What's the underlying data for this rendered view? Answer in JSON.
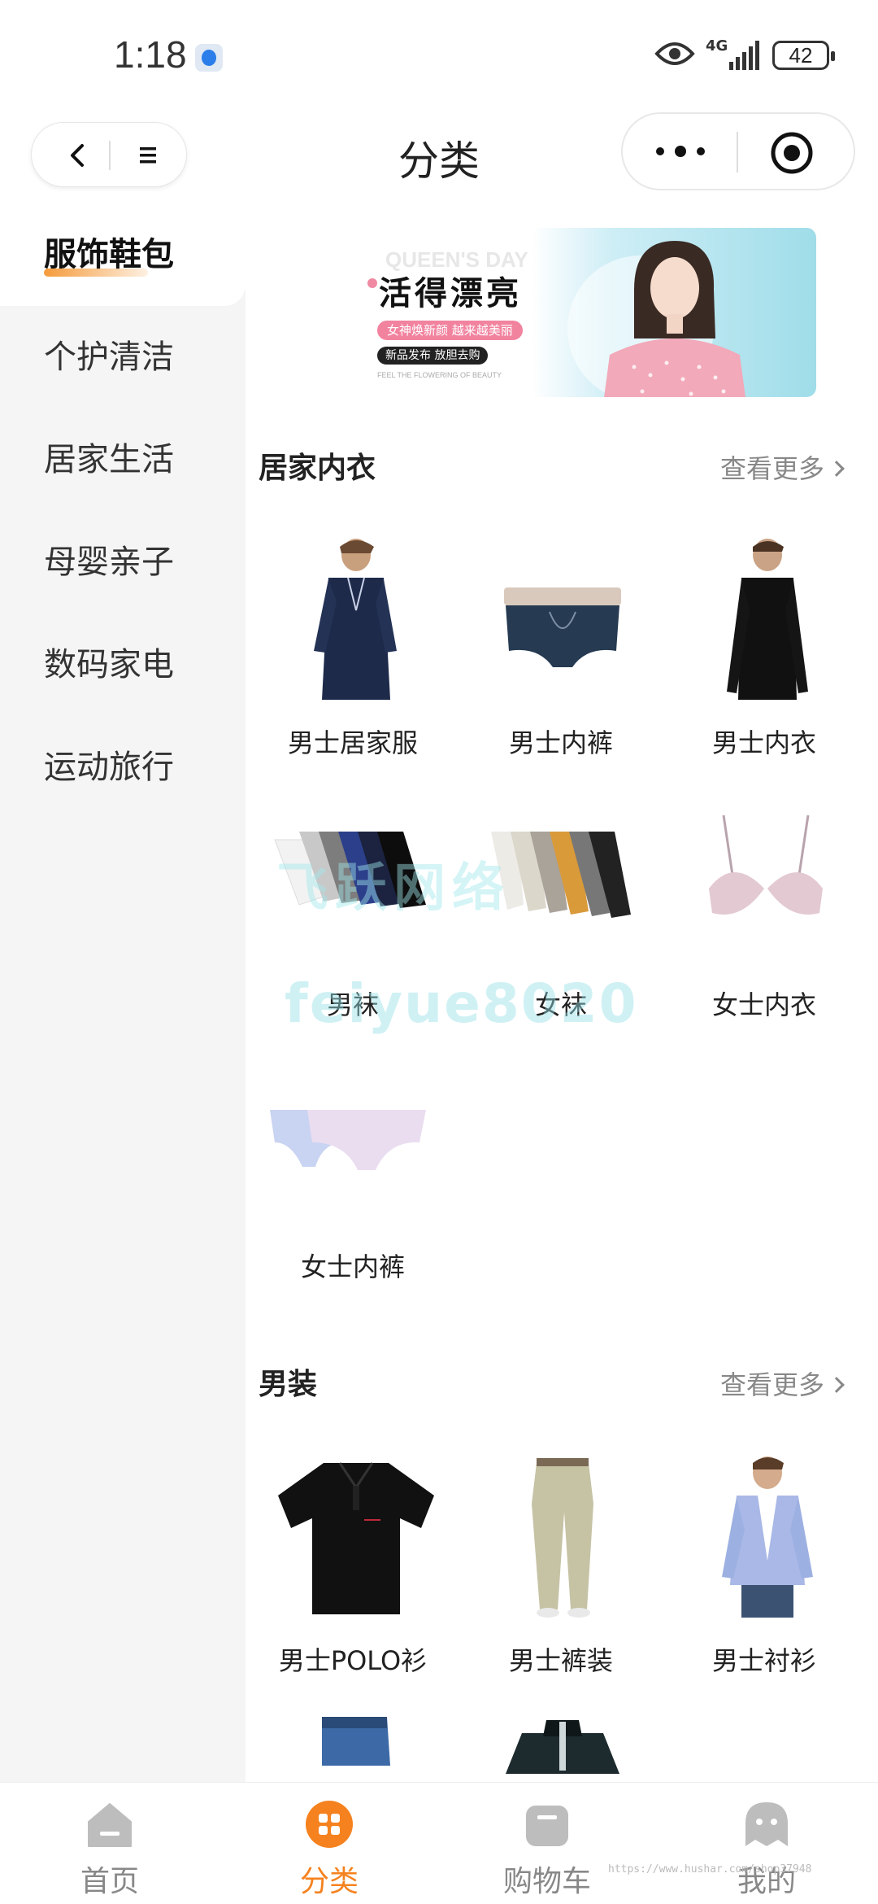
{
  "status_bar": {
    "time": "1:18",
    "network": "4G",
    "battery": "42"
  },
  "nav": {
    "title": "分类"
  },
  "sidebar": {
    "items": [
      {
        "label": "服饰鞋包",
        "active": true
      },
      {
        "label": "个护清洁"
      },
      {
        "label": "居家生活"
      },
      {
        "label": "母婴亲子"
      },
      {
        "label": "数码家电"
      },
      {
        "label": "运动旅行"
      }
    ]
  },
  "banner": {
    "ghost": "QUEEN'S DAY",
    "title": "活得漂亮",
    "pill": "女神焕新颜 越来越美丽",
    "pill2": "新品发布 放胆去购",
    "small": "FEEL THE FLOWERING OF BEAUTY"
  },
  "sections": [
    {
      "title": "居家内衣",
      "more": "查看更多",
      "items": [
        "男士居家服",
        "男士内裤",
        "男士内衣",
        "男袜",
        "女袜",
        "女士内衣",
        "女士内裤"
      ]
    },
    {
      "title": "男装",
      "more": "查看更多",
      "items": [
        "男士POLO衫",
        "男士裤装",
        "男士衬衫"
      ]
    }
  ],
  "watermark": {
    "cn": "飞跃网络",
    "en": "feiyue8020"
  },
  "tabbar": {
    "items": [
      {
        "label": "首页"
      },
      {
        "label": "分类",
        "active": true
      },
      {
        "label": "购物车"
      },
      {
        "label": "我的"
      }
    ]
  },
  "url_mark": "https://www.hushar.com/shop37948",
  "colors": {
    "accent": "#f5821f",
    "sidebar_bg": "#f5f5f5",
    "text": "#222222",
    "muted": "#888888"
  }
}
